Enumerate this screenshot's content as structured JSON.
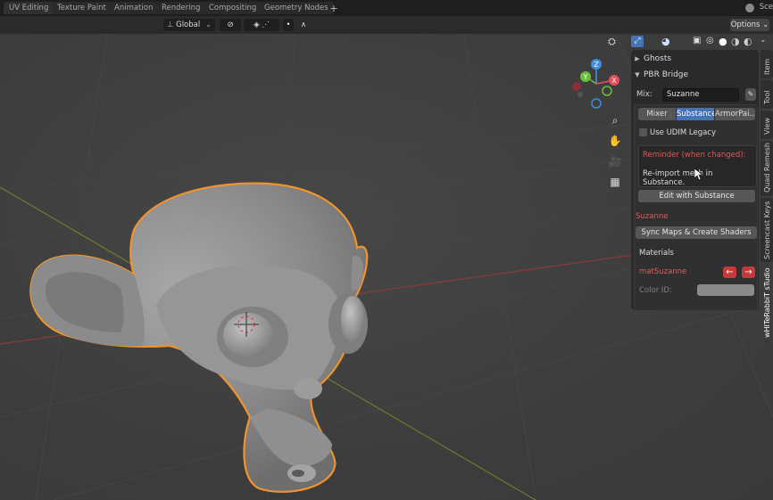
{
  "workspace_tabs": [
    "UV Editing",
    "Texture Paint",
    "Animation",
    "Rendering",
    "Compositing",
    "Geometry Nodes"
  ],
  "scene_label": "Sce",
  "header": {
    "transform_orientation": "Global",
    "options_label": "Options"
  },
  "gizmo": {
    "x": "X",
    "y": "Y",
    "z": "Z"
  },
  "panel": {
    "ghosts_title": "Ghosts",
    "pbr_title": "PBR Bridge",
    "mix_label": "Mix:",
    "mix_value": "Suzanne",
    "tabs": [
      "Mixer",
      "Substance",
      "ArmorPai..."
    ],
    "active_tab": "Substance",
    "udim_label": "Use UDIM Legacy",
    "udim_checked": false,
    "reminder_title": "Reminder (when changed):",
    "reminder_text": "Re-import mesh in Substance.",
    "edit_button": "Edit with Substance",
    "object_name": "Suzanne",
    "sync_button": "Sync Maps & Create Shaders",
    "materials_title": "Materials",
    "material_name": "matSuzanne",
    "color_id_label": "Color ID:"
  },
  "vertical_tabs": [
    "Item",
    "Tool",
    "View",
    "Quad Remesh",
    "Screencast Keys",
    "wHITeRabbiT sTudio"
  ],
  "active_vertical_tab": "wHITeRabbiT sTudio",
  "colors": {
    "accent": "#4772b3",
    "selection_outline": "#f0932d",
    "warning_red": "#d85c5c",
    "gizmo_x": "#e84b5a",
    "gizmo_y": "#6bbf3a",
    "gizmo_z": "#3d8fe0"
  }
}
